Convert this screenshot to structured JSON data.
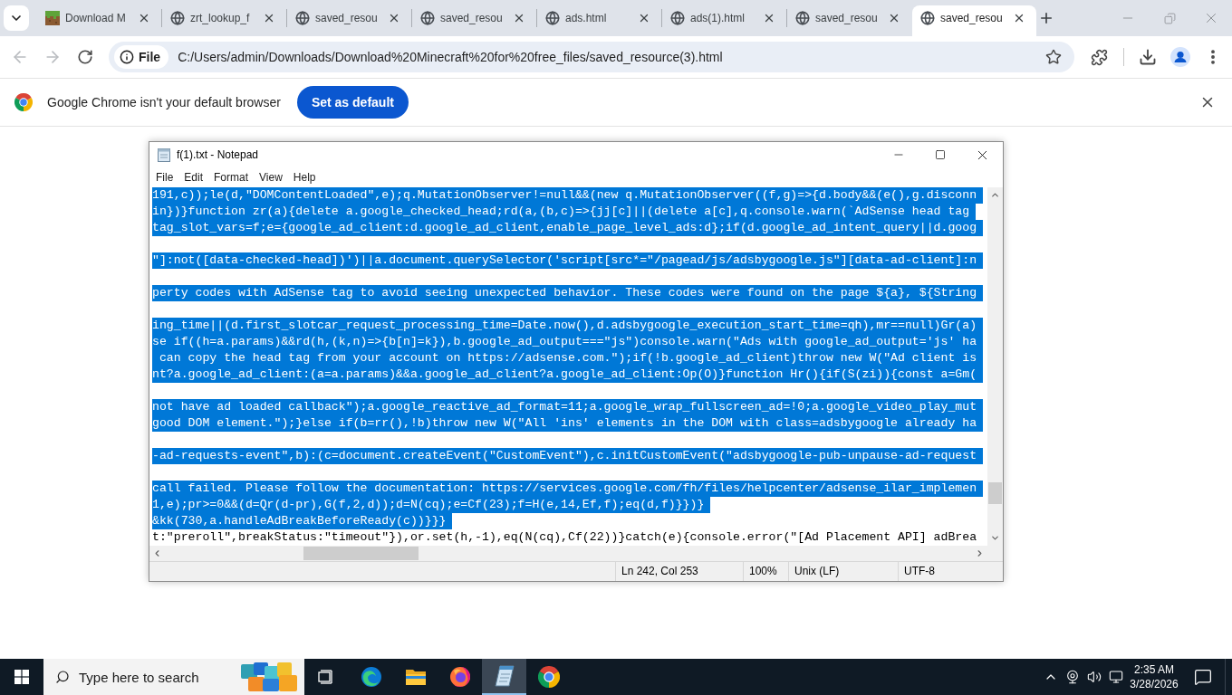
{
  "browser": {
    "tabs": [
      {
        "title": "Download M",
        "kind": "favicon",
        "selected": false
      },
      {
        "title": "zrt_lookup_f",
        "kind": "globe",
        "selected": false
      },
      {
        "title": "saved_resou",
        "kind": "globe",
        "selected": false
      },
      {
        "title": "saved_resou",
        "kind": "globe",
        "selected": false
      },
      {
        "title": "ads.html",
        "kind": "globe",
        "selected": false
      },
      {
        "title": "ads(1).html",
        "kind": "globe",
        "selected": false
      },
      {
        "title": "saved_resou",
        "kind": "globe",
        "selected": false
      },
      {
        "title": "saved_resou",
        "kind": "globe",
        "selected": true
      }
    ],
    "navigation": {
      "back": {
        "disabled": true
      },
      "forward": {
        "disabled": true
      }
    },
    "address": {
      "chip": "File",
      "url": "C:/Users/admin/Downloads/Download%20Minecraft%20for%20free_files/saved_resource(3).html"
    },
    "infobar": {
      "message": "Google Chrome isn't your default browser",
      "button": "Set as default"
    }
  },
  "notepad": {
    "title": "f(1).txt - Notepad",
    "menu": [
      "File",
      "Edit",
      "Format",
      "View",
      "Help"
    ],
    "lines": [
      {
        "kind": "code",
        "text": "191,c));le(d,\"DOMContentLoaded\",e);q.MutationObserver!=null&&(new q.MutationObserver((f,g)=>{d.body&&(e(),g.disconn",
        "selected": true
      },
      {
        "kind": "code",
        "text": "in})}function zr(a){delete a.google_checked_head;rd(a,(b,c)=>{jj[c]||(delete a[c],q.console.warn(`AdSense head tag",
        "selected": true
      },
      {
        "kind": "code",
        "text": "tag_slot_vars=f;e={google_ad_client:d.google_ad_client,enable_page_level_ads:d};if(d.google_ad_intent_query||d.goog",
        "selected": true
      },
      {
        "kind": "blank"
      },
      {
        "kind": "code",
        "text": "\"]:not([data-checked-head])')||a.document.querySelector('script[src*=\"/pagead/js/adsbygoogle.js\"][data-ad-client]:n",
        "selected": true
      },
      {
        "kind": "blank"
      },
      {
        "kind": "code",
        "text": "perty codes with AdSense tag to avoid seeing unexpected behavior. These codes were found on the page ${a}, ${String",
        "selected": true
      },
      {
        "kind": "blank"
      },
      {
        "kind": "code",
        "text": "ing_time||(d.first_slotcar_request_processing_time=Date.now(),d.adsbygoogle_execution_start_time=qh),mr==null)Gr(a)",
        "selected": true
      },
      {
        "kind": "code",
        "text": "se if((h=a.params)&&rd(h,(k,n)=>{b[n]=k}),b.google_ad_output===\"js\")console.warn(\"Ads with google_ad_output='js' ha",
        "selected": true
      },
      {
        "kind": "code",
        "text": " can copy the head tag from your account on https://adsense.com.\");if(!b.google_ad_client)throw new W(\"Ad client is",
        "selected": true
      },
      {
        "kind": "code",
        "text": "nt?a.google_ad_client:(a=a.params)&&a.google_ad_client?a.google_ad_client:Op(O)}function Hr(){if(S(zi)){const a=Gm(",
        "selected": true
      },
      {
        "kind": "blank"
      },
      {
        "kind": "code",
        "text": "not have ad loaded callback\");a.google_reactive_ad_format=11;a.google_wrap_fullscreen_ad=!0;a.google_video_play_mut",
        "selected": true
      },
      {
        "kind": "code",
        "text": "good DOM element.\");}else if(b=rr(),!b)throw new W(\"All 'ins' elements in the DOM with class=adsbygoogle already ha",
        "selected": true
      },
      {
        "kind": "blank"
      },
      {
        "kind": "code",
        "text": "-ad-requests-event\",b):(c=document.createEvent(\"CustomEvent\"),c.initCustomEvent(\"adsbygoogle-pub-unpause-ad-request",
        "selected": true
      },
      {
        "kind": "blank"
      },
      {
        "kind": "code",
        "text": "call failed. Please follow the documentation: https://services.google.com/fh/files/helpcenter/adsense_ilar_implemen",
        "selected": true
      },
      {
        "kind": "code",
        "text": "1,e);pr>=0&&(d=Qr(d-pr),G(f,2,d));d=N(cq);e=Cf(23);f=H(e,14,Ef,f);eq(d,f)}})}",
        "selected": true
      },
      {
        "kind": "code",
        "text": "&kk(730,a.handleAdBreakBeforeReady(c))}}}",
        "selected": true
      },
      {
        "kind": "code",
        "text": "t:\"preroll\",breakStatus:\"timeout\"}),or.set(h,-1),eq(N(cq),Cf(22))}catch(e){console.error(\"[Ad Placement API] adBrea",
        "selected": false
      }
    ],
    "status": [
      "Ln 242, Col 253",
      "100%",
      "Unix (LF)",
      "UTF-8"
    ]
  },
  "taskbar": {
    "search": {
      "placeholder": "Type here to search"
    },
    "apps": [
      {
        "kind": "edge",
        "selected": false
      },
      {
        "kind": "explorer",
        "selected": false
      },
      {
        "kind": "firefox",
        "selected": false
      },
      {
        "kind": "notepad",
        "selected": true
      },
      {
        "kind": "chrome",
        "selected": false
      }
    ],
    "clock": {
      "time": "2:35 AM",
      "date": "3/28/2026"
    }
  }
}
